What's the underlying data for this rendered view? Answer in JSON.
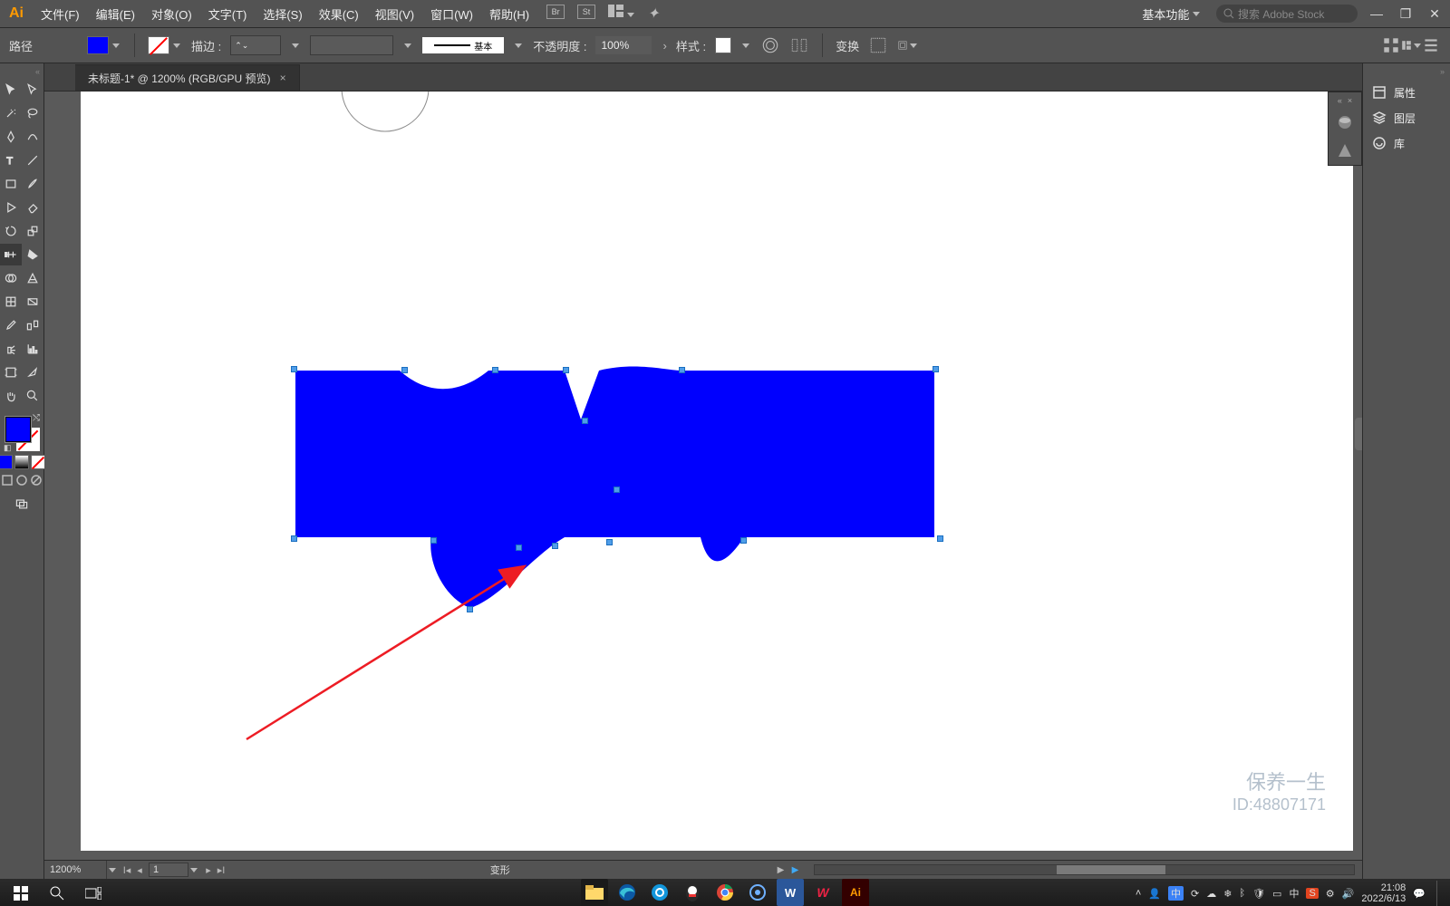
{
  "app": {
    "logo_text": "Ai"
  },
  "menu": {
    "file": "文件(F)",
    "edit": "编辑(E)",
    "object": "对象(O)",
    "type": "文字(T)",
    "select": "选择(S)",
    "effect": "效果(C)",
    "view": "视图(V)",
    "window": "窗口(W)",
    "help": "帮助(H)"
  },
  "topicons": {
    "br": "Br",
    "st": "St"
  },
  "workspace": {
    "label": "基本功能"
  },
  "search": {
    "placeholder": "搜索 Adobe Stock"
  },
  "options": {
    "selection_label": "路径",
    "fill_color": "#0000ff",
    "stroke_label": "描边 :",
    "stroke_weight": "",
    "stroke_style_label": "基本",
    "opacity_label": "不透明度 :",
    "opacity_value": "100%",
    "style_label": "样式 :",
    "transform_label": "变换"
  },
  "document": {
    "tab_title": "未标题-1* @ 1200% (RGB/GPU 预览)",
    "zoom": "1200%",
    "page": "1",
    "status": "变形"
  },
  "rightpanel": {
    "properties": "属性",
    "layers": "图层",
    "library": "库"
  },
  "taskbar": {
    "ime1": "中",
    "ime2": "中",
    "time": "21:08",
    "date": "2022/6/13"
  },
  "watermark": {
    "line1": "保养一生",
    "line2": "ID:48807171"
  },
  "colors": {
    "shape_fill": "#0000fe",
    "arrow": "#ed1c24"
  }
}
